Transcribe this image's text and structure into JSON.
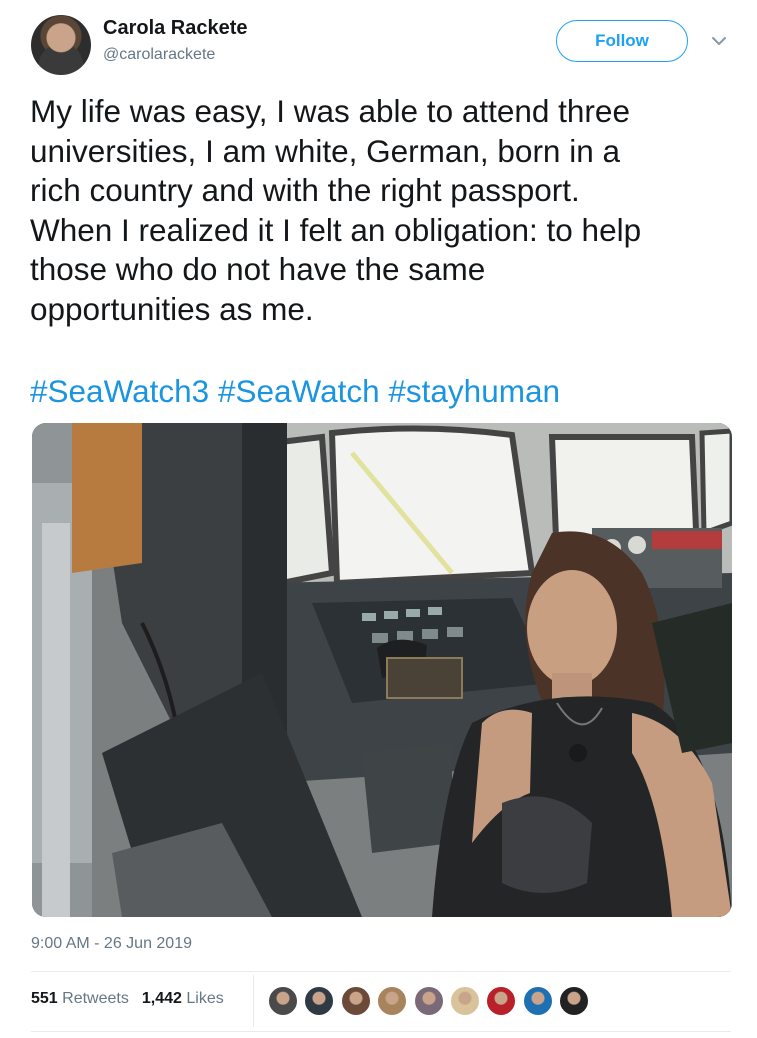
{
  "user": {
    "name": "Carola Rackete",
    "handle": "@carolarackete"
  },
  "header": {
    "follow_label": "Follow",
    "menu_icon": "chevron-down-icon"
  },
  "tweet": {
    "lines": [
      "My life was easy, I was able to attend three",
      "universities, I am white, German, born in a",
      "rich country and with the right passport.",
      "When I realized it I felt an obligation: to help",
      "those who do not have the same",
      "opportunities as me."
    ],
    "hashtags": [
      "#SeaWatch3",
      "#SeaWatch",
      "#stayhuman"
    ],
    "colors": {
      "link": "#1b95e0",
      "accent": "#1da1f2",
      "muted": "#657786"
    }
  },
  "meta": {
    "timestamp": "9:00 AM - 26 Jun 2019"
  },
  "stats": {
    "retweets_count": "551",
    "retweets_label": "Retweets",
    "likes_count": "1,442",
    "likes_label": "Likes"
  },
  "likers": [
    {
      "color": "#4a4a4a"
    },
    {
      "color": "#2f3a44"
    },
    {
      "color": "#6b4a3a"
    },
    {
      "color": "#a8845c"
    },
    {
      "color": "#7a6a78"
    },
    {
      "color": "#d8c39a"
    },
    {
      "color": "#b8202a"
    },
    {
      "color": "#1f6fb3"
    },
    {
      "color": "#222222"
    }
  ]
}
